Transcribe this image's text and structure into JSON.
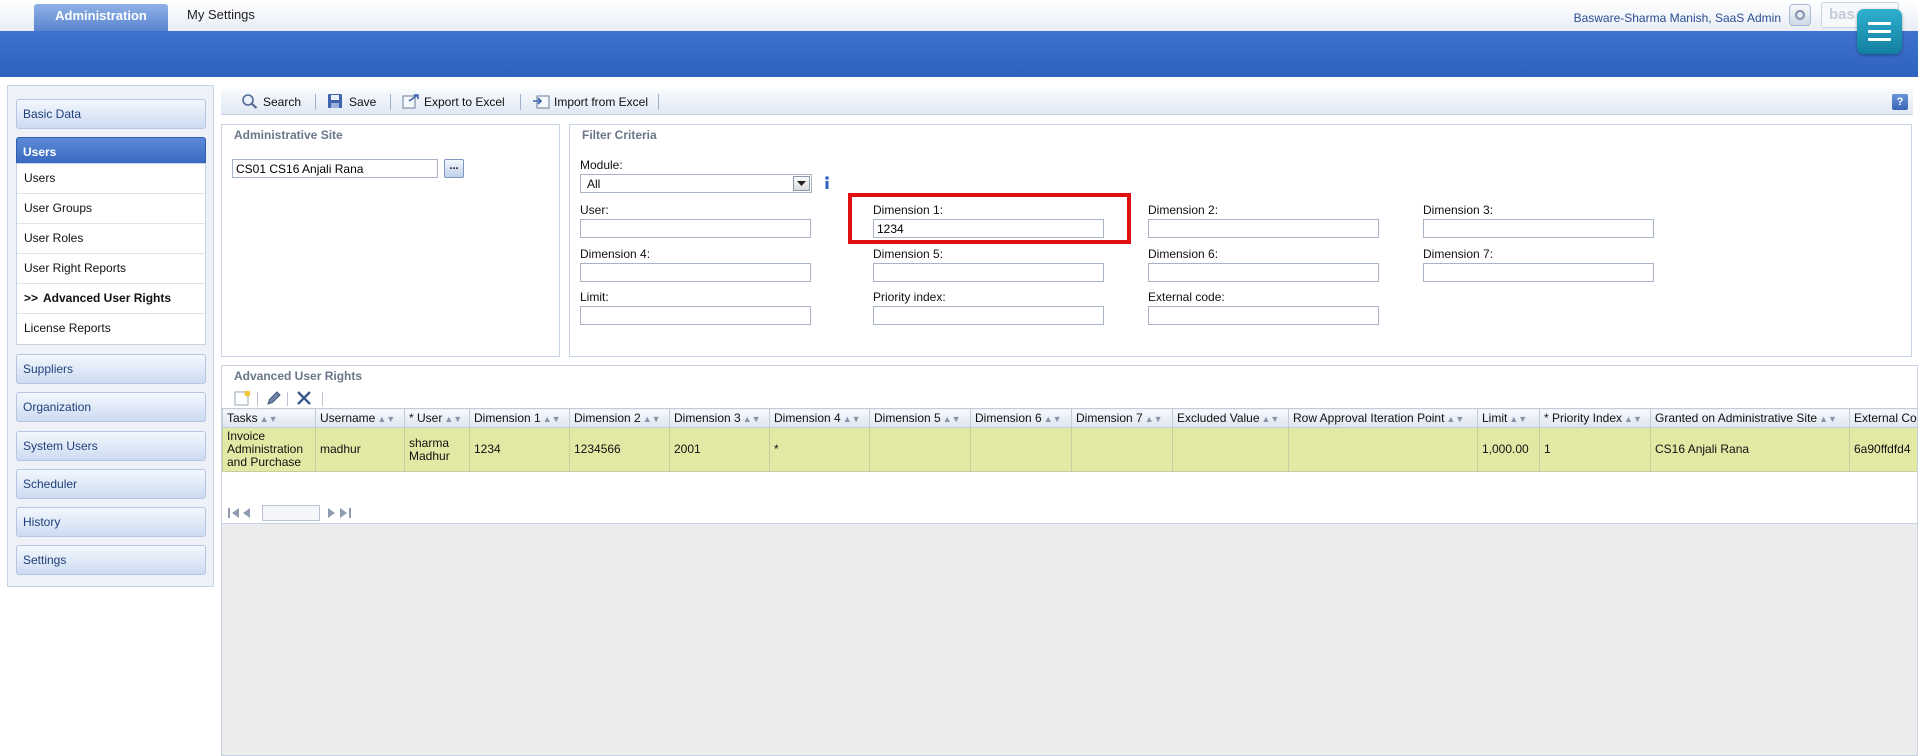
{
  "header": {
    "tabs": [
      "Administration",
      "My Settings"
    ],
    "user": "Basware-Sharma Manish, SaaS Admin",
    "logo_text": "bas"
  },
  "nav": {
    "basic_data": "Basic Data",
    "users": "Users",
    "sub_items": [
      "Users",
      "User Groups",
      "User Roles",
      "User Right Reports",
      "Advanced User Rights",
      "License Reports"
    ],
    "current_marker": ">>",
    "suppliers": "Suppliers",
    "organization": "Organization",
    "system_users": "System Users",
    "scheduler": "Scheduler",
    "history": "History",
    "settings": "Settings"
  },
  "toolbar": {
    "search": "Search",
    "save": "Save",
    "export": "Export to Excel",
    "import": "Import from Excel",
    "help": "?"
  },
  "admin_site": {
    "title": "Administrative Site",
    "value": "CS01 CS16 Anjali Rana",
    "browse": "..."
  },
  "filter": {
    "title": "Filter Criteria",
    "module_label": "Module:",
    "module_value": "All",
    "user_label": "User:",
    "user_value": "",
    "dim1_label": "Dimension 1:",
    "dim1_value": "1234",
    "dim2_label": "Dimension 2:",
    "dim2_value": "",
    "dim3_label": "Dimension 3:",
    "dim3_value": "",
    "dim4_label": "Dimension 4:",
    "dim4_value": "",
    "dim5_label": "Dimension 5:",
    "dim5_value": "",
    "dim6_label": "Dimension 6:",
    "dim6_value": "",
    "dim7_label": "Dimension 7:",
    "dim7_value": "",
    "limit_label": "Limit:",
    "limit_value": "",
    "priority_label": "Priority index:",
    "priority_value": "",
    "external_label": "External code:",
    "external_value": ""
  },
  "grid": {
    "title": "Advanced User Rights",
    "columns": [
      "Tasks",
      "Username",
      "* User",
      "Dimension 1",
      "Dimension 2",
      "Dimension 3",
      "Dimension 4",
      "Dimension 5",
      "Dimension 6",
      "Dimension 7",
      "Excluded Value",
      "Row Approval Iteration Point",
      "Limit",
      "* Priority Index",
      "Granted on Administrative Site",
      "External Code"
    ],
    "rows": [
      [
        "Invoice Administration and Purchase",
        "madhur",
        "sharma Madhur",
        "1234",
        "1234566",
        "2001",
        "*",
        "",
        "",
        "",
        "",
        "",
        "1,000.00",
        "1",
        "CS16 Anjali Rana",
        "6a90ffdfd4"
      ]
    ]
  },
  "colors": {
    "accent_blue": "#2f61be",
    "selected_row": "#e2e9a5",
    "highlight_box": "#e01010"
  }
}
